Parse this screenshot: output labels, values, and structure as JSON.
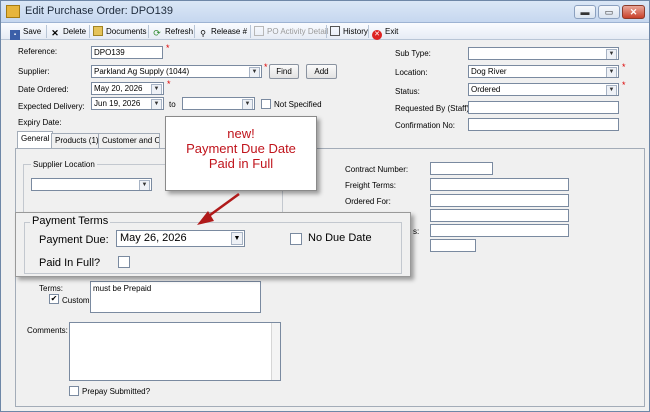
{
  "window": {
    "title": "Edit Purchase Order: DPO139",
    "controls": {
      "minimize": "▬",
      "maximize": "▭",
      "close": "✕"
    }
  },
  "toolbar": {
    "save": "Save",
    "delete": "Delete",
    "documents": "Documents",
    "refresh": "Refresh",
    "release": "Release #",
    "po_activity": "PO Activity Detail",
    "history": "History",
    "exit": "Exit"
  },
  "form": {
    "reference": {
      "label": "Reference:",
      "value": "DPO139"
    },
    "supplier": {
      "label": "Supplier:",
      "value": "Parkland Ag Supply (1044)",
      "find_label": "Find",
      "add_label": "Add"
    },
    "date_ordered": {
      "label": "Date Ordered:",
      "value": "May 20, 2026"
    },
    "expected_delivery": {
      "label": "Expected Delivery:",
      "value": "Jun 19, 2026",
      "to_label": "to",
      "to_value": "",
      "not_specified": "Not Specified"
    },
    "expiry_date": {
      "label": "Expiry Date:"
    },
    "sub_type": {
      "label": "Sub Type:",
      "value": ""
    },
    "location": {
      "label": "Location:",
      "value": "Dog River"
    },
    "status": {
      "label": "Status:",
      "value": "Ordered"
    },
    "requested_by": {
      "label": "Requested By (Staff):",
      "value": ""
    },
    "confirmation_no": {
      "label": "Confirmation No:",
      "value": ""
    }
  },
  "tabs": [
    {
      "label": "General"
    },
    {
      "label": "Products (1)"
    },
    {
      "label": "Customer and Ord"
    }
  ],
  "general": {
    "supplier_location": {
      "label": "Supplier Location",
      "value": ""
    },
    "contract_number": "Contract Number:",
    "freight_terms": "Freight Terms:",
    "ordered_for": "Ordered For:",
    "partial_label": "s:",
    "terms": {
      "label": "Terms:",
      "custom_label": "Custom",
      "custom_checked": "✔",
      "value": "must be Prepaid"
    },
    "comments": {
      "label": "Comments:",
      "value": ""
    },
    "prepay_submitted": "Prepay Submitted?"
  },
  "payment_terms": {
    "title": "Payment Terms",
    "payment_due_label": "Payment Due:",
    "payment_due_value": "May 26, 2026",
    "no_due_date": "No Due Date",
    "paid_in_full": "Paid In Full?"
  },
  "callout": {
    "line1": "new!",
    "line2": "Payment Due Date",
    "line3": "Paid in Full"
  },
  "colors": {
    "callout_text": "#c0141c",
    "arrow": "#b01a1a",
    "required": "#dd0000"
  }
}
